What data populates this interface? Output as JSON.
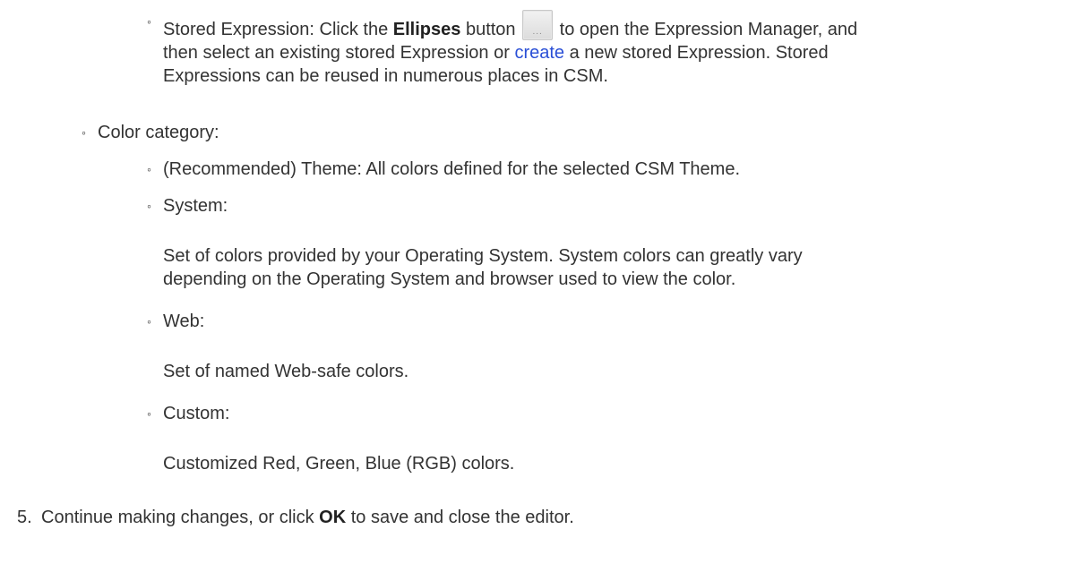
{
  "stored_expression": {
    "label_prefix": "Stored Expression: Click the ",
    "button_name": "Ellipses",
    "button_word": " button ",
    "ellipsis_glyph": "...",
    "after_button": " to open the Expression Manager, and",
    "line2_before_link": "then select an existing stored Expression or ",
    "link_text": "create",
    "line2_after_link": " a new stored Expression. Stored",
    "line3": "Expressions can be reused in numerous places in CSM."
  },
  "color_category": {
    "label": "Color category:",
    "theme": "(Recommended) Theme: All colors defined for the selected CSM Theme.",
    "system_label": "System:",
    "system_desc_line1": "Set of colors provided by your Operating System. System colors can greatly vary",
    "system_desc_line2": "depending on the Operating System and browser used to view the color.",
    "web_label": "Web:",
    "web_desc": "Set of named Web-safe colors.",
    "custom_label": "Custom:",
    "custom_desc": "Customized Red, Green, Blue (RGB) colors."
  },
  "step5": {
    "number": "5.",
    "before_ok": "Continue making changes, or click ",
    "ok": "OK",
    "after_ok": " to save and close the editor."
  },
  "bullet_glyph": "◦",
  "colors": {
    "text": "#333333",
    "link": "#2a4fd6"
  }
}
